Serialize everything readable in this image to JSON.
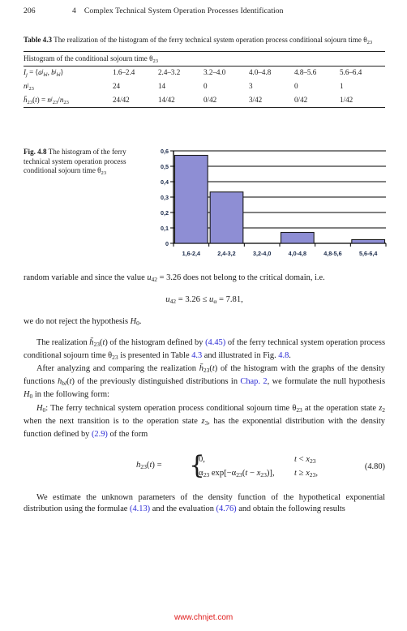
{
  "header": {
    "folio": "206",
    "chapter_number": "4",
    "chapter_title": "Complex Technical System Operation Processes Identification"
  },
  "table": {
    "label": "Table 4.3",
    "caption_text": "The realization of the histogram of the ferry technical system operation process conditional sojourn time θ",
    "caption_sub": "23",
    "spanner": "Histogram of the conditional sojourn time θ",
    "spanner_sub": "23",
    "row_labels": [
      "Iⱼ = ⟨aʲʙₗ, bʲʙₗ⟩",
      "nʲ₂₃",
      "h̄₂₃(t) = nʲ₂₃/n₂₃"
    ],
    "intervals": [
      "1.6–2.4",
      "2.4–3.2",
      "3.2–4.0",
      "4.0–4.8",
      "4.8–5.6",
      "5.6–6.4"
    ],
    "counts": [
      "24",
      "14",
      "0",
      "3",
      "0",
      "1"
    ],
    "frequencies": [
      "24/42",
      "14/42",
      "0/42",
      "3/42",
      "0/42",
      "1/42"
    ]
  },
  "figure": {
    "label": "Fig. 4.8",
    "caption_text": "The histogram of the ferry technical system operation process conditional sojourn time θ",
    "caption_sub": "23"
  },
  "chart_data": {
    "type": "bar",
    "title": "",
    "categories": [
      "1,6-2,4",
      "2,4-3,2",
      "3,2-4,0",
      "4,0-4,8",
      "4,8-5,6",
      "5,6-6,4"
    ],
    "values": [
      0.571,
      0.333,
      0.0,
      0.071,
      0.0,
      0.024
    ],
    "ytick_labels": [
      "0",
      "0,1",
      "0,2",
      "0,3",
      "0,4",
      "0,5",
      "0,6"
    ],
    "ytick_values": [
      0,
      0.1,
      0.2,
      0.3,
      0.4,
      0.5,
      0.6
    ],
    "ylim": [
      0,
      0.6
    ],
    "xlabel": "",
    "ylabel": "",
    "grid": "horizontal",
    "legend": "none",
    "bar_fill": "#8e8ed4",
    "bar_stroke": "#1a1a1a",
    "axis_color": "#000000"
  },
  "body": {
    "para1_a": "random variable and since the value ",
    "para1_u": "u",
    "para1_u_sub": "42",
    "para1_b": " = 3.26 does not belong to the critical domain, i.e.",
    "eq_display_1": "u₄₂ = 3.26 ≤ uₐ = 7.81,",
    "para2": "we do not reject the hypothesis H₀.",
    "para3": "The realization h̄₂₃(t) of the histogram defined by (4.45) of the ferry technical system operation process conditional sojourn time θ₂₃ is presented in Table 4.3 and illustrated in Fig. 4.8.",
    "para3_refs": [
      "(4.45)",
      "4.3",
      "4.8"
    ],
    "para4": "After analyzing and comparing the realization h̄₂₃(t) of the histogram with the graphs of the density functions hʙₗ(t) of the previously distinguished distributions in Chap. 2, we formulate the null hypothesis H₀ in the following form:",
    "para4_ref": "Chap. 2",
    "para5": "H₀: The ferry technical system operation process conditional sojourn time θ₂₃ at the operation state z₂ when the next transition is to the operation state z₃, has the exponential distribution with the density function defined by (2.9) of the form",
    "para5_ref": "(2.9)",
    "equation_480": {
      "lhs": "h₂₃(t) =",
      "case_1": "0,",
      "cond_1": "t < x₂₃",
      "case_2": "α₂₃ exp[−α₂₃(t − x₂₃)],",
      "cond_2": "t ≥ x₂₃,",
      "tag": "(4.80)"
    },
    "para6": "We estimate the unknown parameters of the density function of the hypothetical exponential distribution using the formulae (4.13) and the evaluation (4.76) and obtain the following results",
    "para6_refs": [
      "(4.13)",
      "(4.76)"
    ]
  },
  "watermark": "www.chnjet.com"
}
